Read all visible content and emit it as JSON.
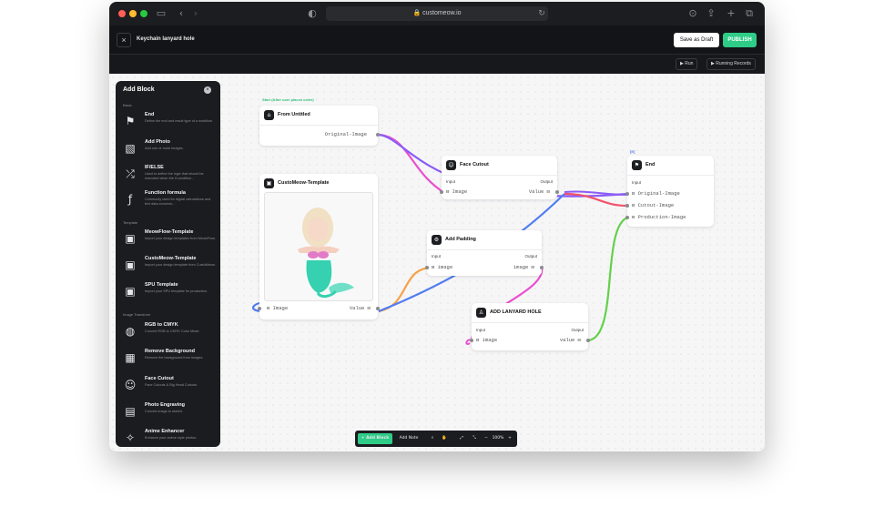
{
  "browser": {
    "url": "customeow.io"
  },
  "header": {
    "title": "Keychain lanyard hole",
    "save_draft": "Save as Draft",
    "publish": "PUBLISH"
  },
  "toolbar": {
    "run": "Run",
    "running_records": "Running Records"
  },
  "panel": {
    "title": "Add Block",
    "sections": [
      {
        "label": "Basic",
        "items": [
          {
            "title": "End",
            "desc": "Define the end and result type of a workflow.",
            "icon": "flag-icon"
          },
          {
            "title": "Add Photo",
            "desc": "Add one or more images.",
            "icon": "photo-icon"
          },
          {
            "title": "IF/ELSE",
            "desc": "Used to define the logic that should be executed when the if condition...",
            "icon": "branch-icon"
          },
          {
            "title": "Function formula",
            "desc": "Commonly used for digital calculations and text data conversi...",
            "icon": "function-icon"
          }
        ]
      },
      {
        "label": "Template",
        "items": [
          {
            "title": "MeowFlow-Template",
            "desc": "Import your design templates from MeowFlow.",
            "icon": "template-icon"
          },
          {
            "title": "CustoMeow-Template",
            "desc": "Import your design template from CustoMeow.",
            "icon": "template-icon"
          },
          {
            "title": "SPU Template",
            "desc": "Import your SPU template for production.",
            "icon": "template-icon"
          }
        ]
      },
      {
        "label": "Image Transform",
        "items": [
          {
            "title": "RGB to CMYK",
            "desc": "Convert RGB to CMYK Color Mode.",
            "icon": "rgb-icon"
          },
          {
            "title": "Remove Background",
            "desc": "Remove the background from images.",
            "icon": "remove-bg-icon"
          },
          {
            "title": "Face Cutout",
            "desc": "Face Cutouts & Big Head Cutouts.",
            "icon": "face-icon"
          },
          {
            "title": "Photo Engraving",
            "desc": "Convert image to sketch.",
            "icon": "engraving-icon"
          },
          {
            "title": "Anime Enhancer",
            "desc": "Enhance your anime style photos.",
            "icon": "anime-icon"
          }
        ]
      }
    ]
  },
  "canvas": {
    "start_tag": "Start (After user places order)",
    "end_tag": "[E]",
    "nodes": {
      "from_untitled": {
        "title": "From Untitled",
        "output": "Original-Image"
      },
      "template": {
        "title": "CustoMeow-Template",
        "input": "Image",
        "output": "Value"
      },
      "face_cutout": {
        "title": "Face Cutout",
        "input_label": "Input",
        "output_label": "Output",
        "input": "Image",
        "output": "Value"
      },
      "add_padding": {
        "title": "Add Padding",
        "input_label": "Input",
        "output_label": "Output",
        "input": "image",
        "output": "image"
      },
      "lanyard": {
        "title": "ADD LANYARD HOLE",
        "input_label": "Input",
        "output_label": "Output",
        "input": "image",
        "output": "value"
      },
      "end": {
        "title": "End",
        "input_label": "Input",
        "inputs": [
          "Original-Image",
          "Cutout-Image",
          "Production-Image"
        ]
      }
    }
  },
  "zoombar": {
    "add_block": "Add Block",
    "add_note": "Add Note",
    "zoom": "100%"
  },
  "colors": {
    "accent": "#2ecc87",
    "wire_pink": "#e94fd0",
    "wire_purple": "#8b5cf6",
    "wire_blue": "#4f7cf0",
    "wire_orange": "#f5a24a",
    "wire_green": "#63d14a",
    "wire_red": "#f0536b"
  }
}
